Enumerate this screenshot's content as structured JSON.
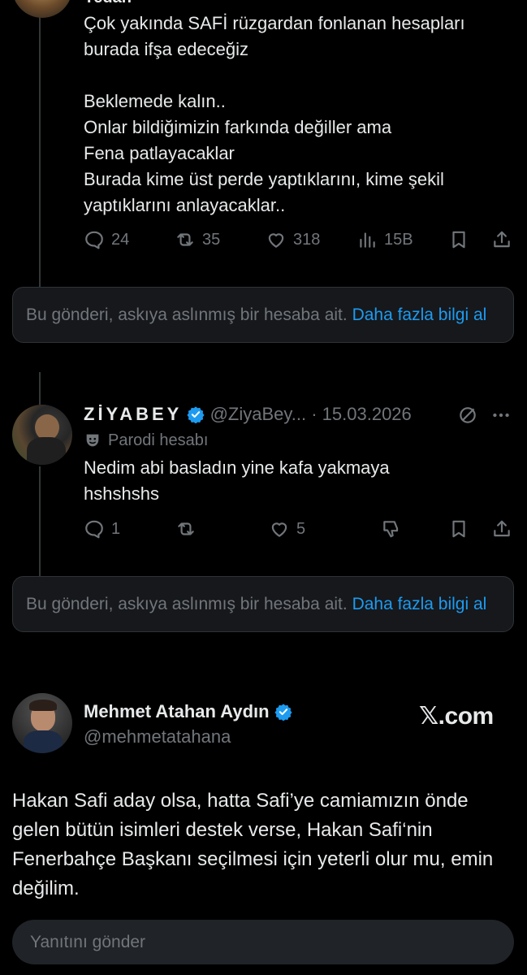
{
  "tweet1": {
    "author_partial": "Yedan",
    "text": "Çok yakında SAFİ rüzgardan fonlanan hesapları burada ifşa edeceğiz\n\nBeklemede kalın..\nOnlar bildiğimizin farkında değiller ama\nFena patlayacaklar\nBurada kime üst perde yaptıklarını, kime şekil yaptıklarını anlayacaklar..",
    "replies": "24",
    "reposts": "35",
    "likes": "318",
    "views": "15B"
  },
  "notice1": {
    "text": "Bu gönderi, askıya aslınmış bir hesaba ait.",
    "link": "Daha fazla bilgi al"
  },
  "tweet2": {
    "name": "ZİYABEY",
    "handle": "@ZiyaBey...",
    "dot": "·",
    "date": "15.03.2026",
    "parody_label": "Parodi hesabı",
    "text": "Nedim abi basladın yine kafa yakmaya hshshshs",
    "replies": "1",
    "likes": "5"
  },
  "notice2": {
    "text": "Bu gönderi, askıya aslınmış bir hesaba ait.",
    "link": "Daha fazla bilgi al"
  },
  "tweet3": {
    "name": "Mehmet Atahan Aydın",
    "handle": "@mehmetatahana",
    "watermark": "𝕏.com",
    "text": "Hakan Safi aday olsa, hatta Safi’ye camiamızın önde gelen bütün isimleri destek verse, Hakan Safi‘nin Fenerbahçe Başkanı seçilmesi için yeterli olur mu, emin değilim."
  },
  "reply": {
    "placeholder": "Yanıtını gönder"
  },
  "colors": {
    "background": "#000000",
    "text": "#e7e9ea",
    "muted": "#71767b",
    "link": "#1d9bf0",
    "verified": "#1d9bf0",
    "notice_bg": "#16181c"
  }
}
